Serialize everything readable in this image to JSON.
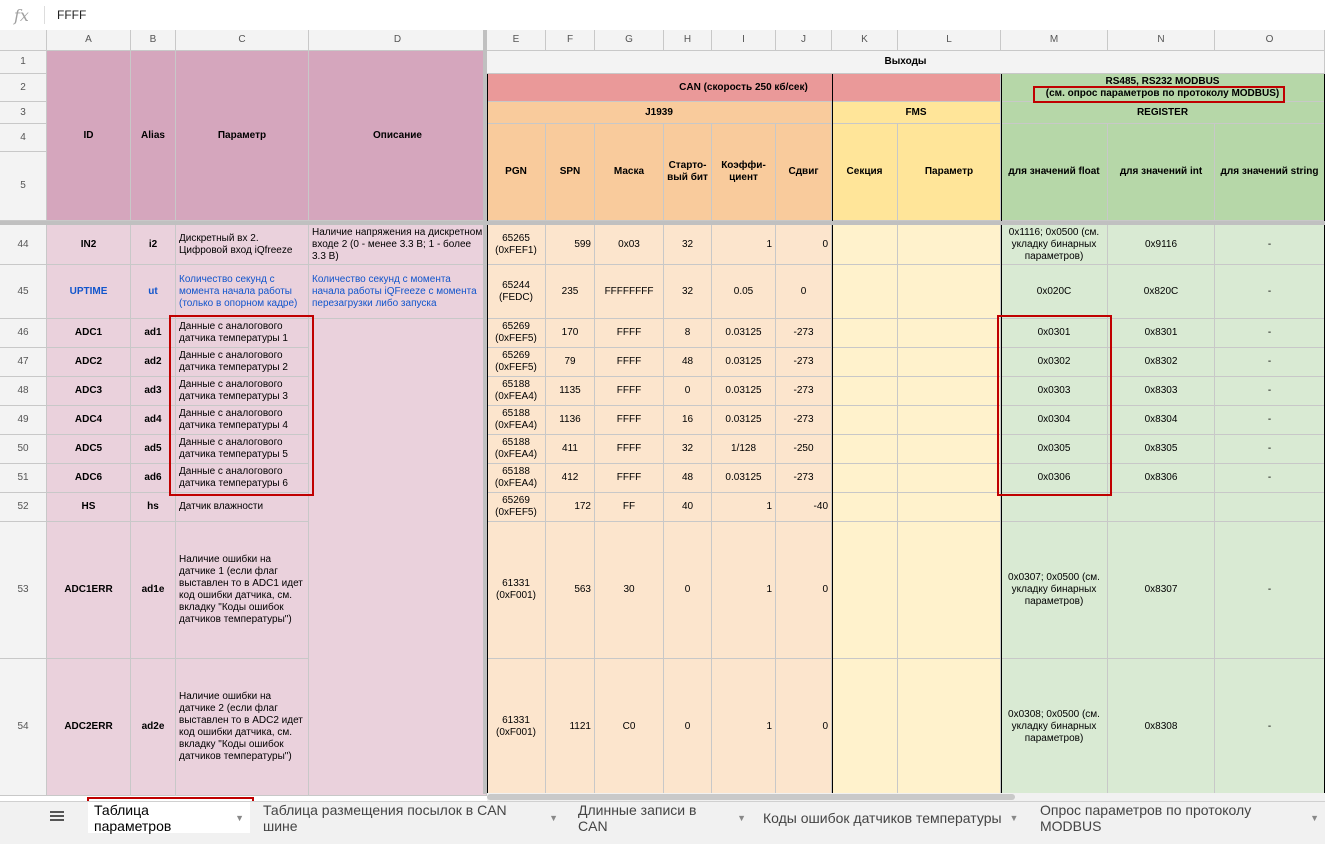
{
  "formula_bar": {
    "fx": "fx",
    "value": "FFFF"
  },
  "columns": [
    "A",
    "B",
    "C",
    "D",
    "E",
    "F",
    "G",
    "H",
    "I",
    "J",
    "K",
    "L",
    "M",
    "N",
    "O"
  ],
  "header_rows": [
    "1",
    "2",
    "3",
    "4",
    "5"
  ],
  "headers": {
    "id": "ID",
    "alias": "Alias",
    "param": "Параметр",
    "desc": "Описание",
    "outputs": "Выходы",
    "can": "CAN (скорость 250 кб/сек)",
    "rs485_line1": "RS485, RS232 MODBUS",
    "rs485_line2": "(см. опрос параметров по протоколу MODBUS)",
    "j1939": "J1939",
    "fms": "FMS",
    "register": "REGISTER",
    "pgn": "PGN",
    "spn": "SPN",
    "mask": "Маска",
    "startbit": "Старто-вый бит",
    "coef": "Коэффи-циент",
    "shift": "Сдвиг",
    "section": "Секция",
    "fms_param": "Параметр",
    "float": "для значений float",
    "int": "для значений int",
    "string": "для значений string"
  },
  "rows": [
    {
      "num": "44",
      "id": "IN2",
      "alias": "i2",
      "param": "Дискретный вх 2. Цифровой вход iQfreeze",
      "desc": "Наличие напряжения на дискретном входе 2 (0 - менее 3.3 В; 1 - более 3.3 В)",
      "pgn": "65265 (0xFEF1)",
      "spn": "599",
      "mask": "0x03",
      "startbit": "32",
      "coef": "1",
      "shift": "0",
      "float": "0x1116; 0x0500 (см. укладку бинарных параметров)",
      "int": "0x9116",
      "string": "-"
    },
    {
      "num": "45",
      "id": "UPTIME",
      "alias": "ut",
      "param": "Количество секунд с момента начала работы (только в опорном кадре)",
      "desc": "Количество секунд с момента начала работы iQFreeze с момента перезагрузки либо запуска",
      "pgn": "65244 (FEDC)",
      "spn": "235",
      "mask": "FFFFFFFF",
      "startbit": "32",
      "coef": "0.05",
      "shift": "0",
      "float": "0x020C",
      "int": "0x820C",
      "string": "-"
    },
    {
      "num": "46",
      "id": "ADC1",
      "alias": "ad1",
      "param": "Данные с аналогового датчика температуры 1",
      "desc": "",
      "pgn": "65269 (0xFEF5)",
      "spn": "170",
      "mask": "FFFF",
      "startbit": "8",
      "coef": "0.03125",
      "shift": "-273",
      "float": "0x0301",
      "int": "0x8301",
      "string": "-"
    },
    {
      "num": "47",
      "id": "ADC2",
      "alias": "ad2",
      "param": "Данные с аналогового датчика температуры 2",
      "desc": "",
      "pgn": "65269 (0xFEF5)",
      "spn": "79",
      "mask": "FFFF",
      "startbit": "48",
      "coef": "0.03125",
      "shift": "-273",
      "float": "0x0302",
      "int": "0x8302",
      "string": "-"
    },
    {
      "num": "48",
      "id": "ADC3",
      "alias": "ad3",
      "param": "Данные с аналогового датчика температуры 3",
      "desc": "",
      "pgn": "65188 (0xFEA4)",
      "spn": "1135",
      "mask": "FFFF",
      "startbit": "0",
      "coef": "0.03125",
      "shift": "-273",
      "float": "0x0303",
      "int": "0x8303",
      "string": "-"
    },
    {
      "num": "49",
      "id": "ADC4",
      "alias": "ad4",
      "param": "Данные с аналогового датчика температуры 4",
      "desc": "",
      "pgn": "65188 (0xFEA4)",
      "spn": "1136",
      "mask": "FFFF",
      "startbit": "16",
      "coef": "0.03125",
      "shift": "-273",
      "float": "0x0304",
      "int": "0x8304",
      "string": "-"
    },
    {
      "num": "50",
      "id": "ADC5",
      "alias": "ad5",
      "param": "Данные с аналогового датчика температуры 5",
      "desc": "",
      "pgn": "65188 (0xFEA4)",
      "spn": "411",
      "mask": "FFFF",
      "startbit": "32",
      "coef": "1/128",
      "shift": "-250",
      "float": "0x0305",
      "int": "0x8305",
      "string": "-"
    },
    {
      "num": "51",
      "id": "ADC6",
      "alias": "ad6",
      "param": "Данные с аналогового датчика температуры 6",
      "desc": "",
      "pgn": "65188 (0xFEA4)",
      "spn": "412",
      "mask": "FFFF",
      "startbit": "48",
      "coef": "0.03125",
      "shift": "-273",
      "float": "0x0306",
      "int": "0x8306",
      "string": "-"
    },
    {
      "num": "52",
      "id": "HS",
      "alias": "hs",
      "param": "Датчик влажности",
      "desc": "",
      "pgn": "65269 (0xFEF5)",
      "spn": "172",
      "mask": "FF",
      "startbit": "40",
      "coef": "1",
      "shift": "-40",
      "float": "",
      "int": "",
      "string": ""
    },
    {
      "num": "53",
      "id": "ADC1ERR",
      "alias": "ad1e",
      "param": "Наличие ошибки на датчике 1 (если флаг выставлен то в ADC1 идет код ошибки датчика, см. вкладку \"Коды ошибок датчиков температуры\")",
      "desc": "",
      "pgn": "61331 (0xF001)",
      "spn": "563",
      "mask": "30",
      "startbit": "0",
      "coef": "1",
      "shift": "0",
      "float": "0x0307; 0x0500 (см. укладку бинарных параметров)",
      "int": "0x8307",
      "string": "-"
    },
    {
      "num": "54",
      "id": "ADC2ERR",
      "alias": "ad2e",
      "param": "Наличие ошибки на датчике 2 (если флаг выставлен то в ADC2 идет код ошибки датчика, см. вкладку \"Коды ошибок датчиков температуры\")",
      "desc": "",
      "pgn": "61331 (0xF001)",
      "spn": "1121",
      "mask": "C0",
      "startbit": "0",
      "coef": "1",
      "shift": "0",
      "float": "0x0308; 0x0500 (см. укладку бинарных параметров)",
      "int": "0x8308",
      "string": "-"
    }
  ],
  "sheet_tabs": [
    {
      "label": "Таблица параметров",
      "active": true
    },
    {
      "label": "Таблица размещения посылок в CAN шине",
      "active": false
    },
    {
      "label": "Длинные записи в CAN",
      "active": false
    },
    {
      "label": "Коды ошибок датчиков температуры",
      "active": false
    },
    {
      "label": "Опрос параметров по протоколу MODBUS",
      "active": false
    }
  ],
  "colors": {
    "highlight_box": "#c00000",
    "pink_header": "#d5a6bd",
    "can_header": "#ea9999",
    "j1939_header": "#f9cb9c",
    "fms_header": "#ffe599",
    "modbus_header": "#b6d7a8"
  }
}
